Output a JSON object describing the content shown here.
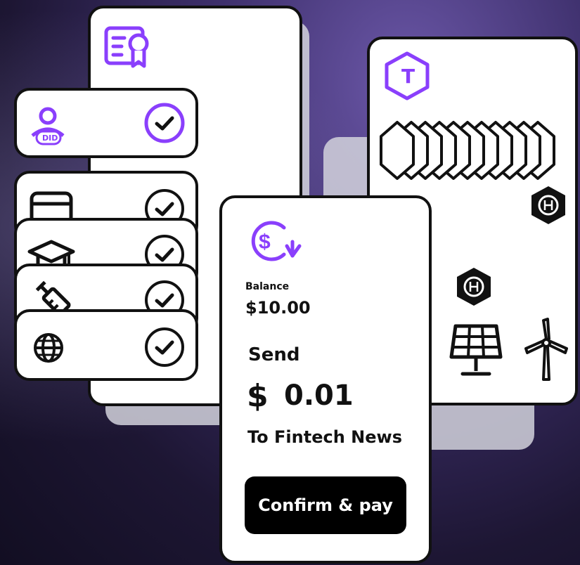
{
  "colors": {
    "accent": "#8a3ffc",
    "ink": "#111111",
    "card": "#ffffff"
  },
  "did_card": {
    "badge_label": "DID"
  },
  "payment_card": {
    "balance_label": "Balance",
    "balance_value": "$10.00",
    "send_label": "Send",
    "amount_symbol": "$",
    "amount_value": "0.01",
    "recipient": "To Fintech News",
    "confirm_button": "Confirm & pay"
  },
  "token_card": {
    "badge_letter": "T"
  },
  "icons": [
    "certificate-icon",
    "user-did-icon",
    "credit-card-icon",
    "graduation-cap-icon",
    "syringe-icon",
    "globe-icon",
    "dollar-refresh-icon",
    "token-t-icon",
    "hbar-icon",
    "tree-icon",
    "solar-panel-icon",
    "wind-turbine-icon",
    "check-circle-icon"
  ]
}
